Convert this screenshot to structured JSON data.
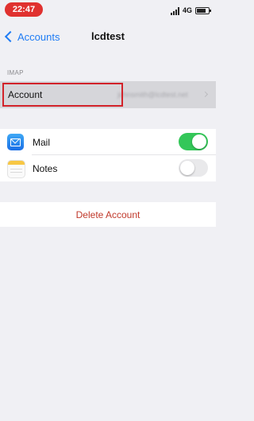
{
  "status_bar": {
    "time": "22:47",
    "network": "4G",
    "time_pill_color": "#e0312f"
  },
  "nav": {
    "back_label": "Accounts",
    "title": "lcdtest"
  },
  "account_section": {
    "header": "IMAP",
    "account_label": "Account",
    "account_value": "johnsmith@lcdtest.net"
  },
  "apps": [
    {
      "label": "Mail",
      "icon": "mail-icon",
      "enabled": true
    },
    {
      "label": "Notes",
      "icon": "notes-icon",
      "enabled": false
    }
  ],
  "delete_label": "Delete Account",
  "colors": {
    "accent": "#1f7cf4",
    "toggle_on": "#34c759",
    "destructive": "#c0392b",
    "highlight_border": "#d2232a"
  }
}
